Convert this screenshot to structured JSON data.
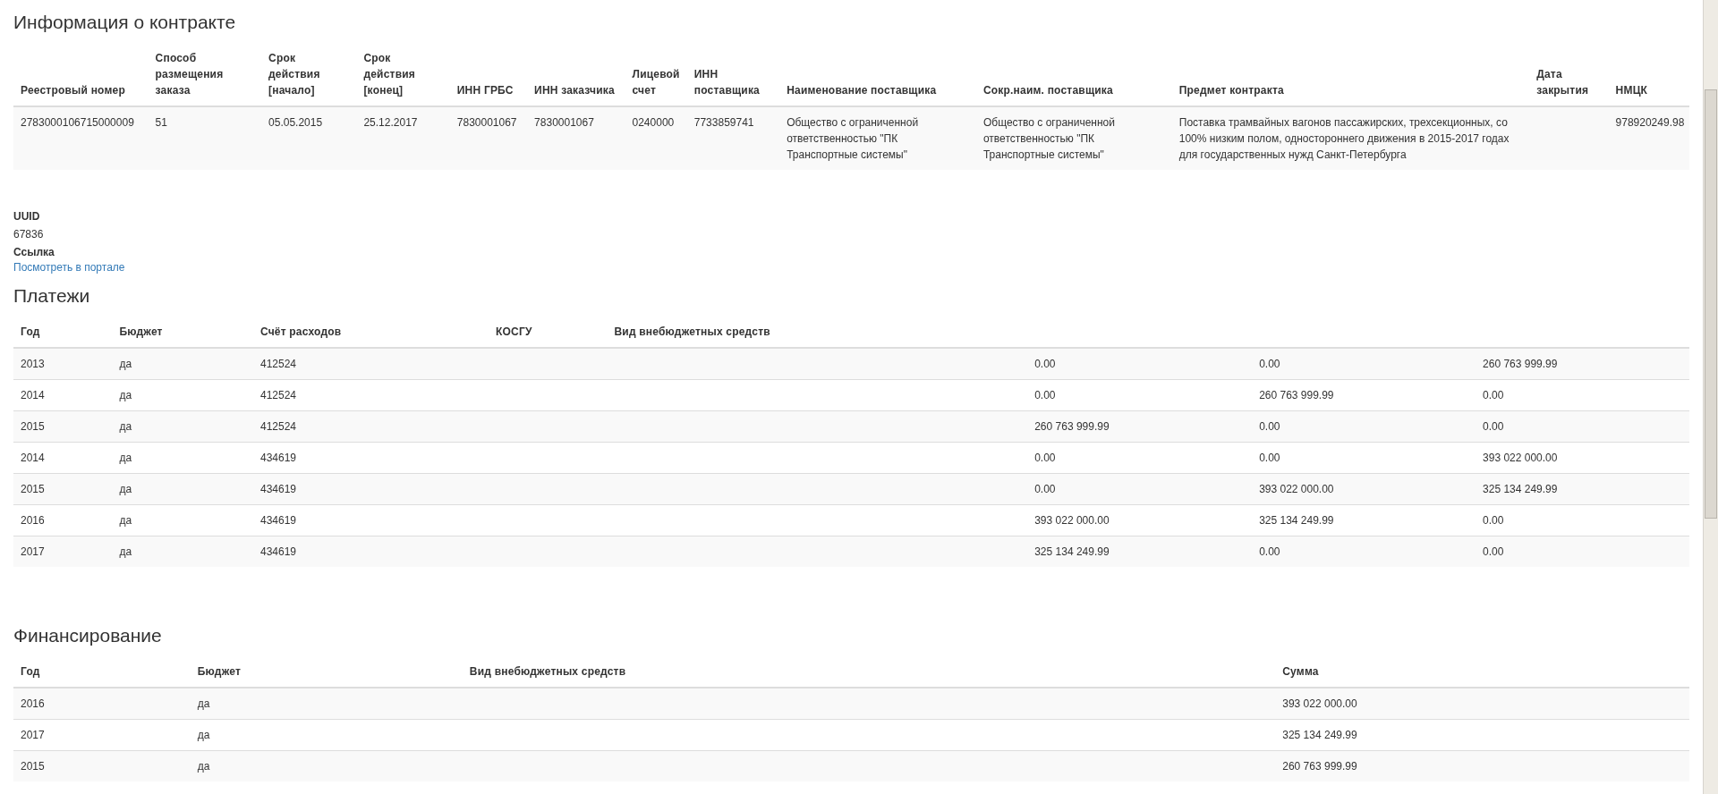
{
  "contract": {
    "title": "Информация о контракте",
    "columns": [
      "Реестровый номер",
      "Способ размещения заказа",
      "Срок действия [начало]",
      "Срок действия [конец]",
      "ИНН ГРБС",
      "ИНН заказчика",
      "Лицевой счет",
      "ИНН поставщика",
      "Наименование поставщика",
      "Сокр.наим. поставщика",
      "Предмет контракта",
      "Дата закрытия",
      "НМЦК"
    ],
    "rows": [
      [
        "2783000106715000009",
        "51",
        "05.05.2015",
        "25.12.2017",
        "7830001067",
        "7830001067",
        "0240000",
        "7733859741",
        "Общество с ограниченной ответственностью \"ПК Транспортные системы\"",
        "Общество с ограниченной ответственностью \"ПК Транспортные системы\"",
        "Поставка трамвайных вагонов пассажирских, трехсекционных, со 100% низким полом, одностороннего движения в 2015-2017 годах для государственных нужд Санкт-Петербурга",
        "",
        "978920249.98"
      ]
    ]
  },
  "details": [
    {
      "label": "UUID",
      "value": "67836",
      "kind": "text"
    },
    {
      "label": "Ссылка",
      "value": "Посмотреть в портале",
      "kind": "link"
    }
  ],
  "payments": {
    "title": "Платежи",
    "columns": [
      "Год",
      "Бюджет",
      "Счёт расходов",
      "КОСГУ",
      "Вид внебюджетных средств",
      "",
      "",
      ""
    ],
    "rows": [
      [
        "2013",
        "да",
        "412524",
        "",
        "",
        "0.00",
        "0.00",
        "260 763 999.99"
      ],
      [
        "2014",
        "да",
        "412524",
        "",
        "",
        "0.00",
        "260 763 999.99",
        "0.00"
      ],
      [
        "2015",
        "да",
        "412524",
        "",
        "",
        "260 763 999.99",
        "0.00",
        "0.00"
      ],
      [
        "2014",
        "да",
        "434619",
        "",
        "",
        "0.00",
        "0.00",
        "393 022 000.00"
      ],
      [
        "2015",
        "да",
        "434619",
        "",
        "",
        "0.00",
        "393 022 000.00",
        "325 134 249.99"
      ],
      [
        "2016",
        "да",
        "434619",
        "",
        "",
        "393 022 000.00",
        "325 134 249.99",
        "0.00"
      ],
      [
        "2017",
        "да",
        "434619",
        "",
        "",
        "325 134 249.99",
        "0.00",
        "0.00"
      ]
    ]
  },
  "financing": {
    "title": "Финансирование",
    "columns": [
      "Год",
      "Бюджет",
      "Вид внебюджетных средств",
      "Сумма"
    ],
    "rows": [
      [
        "2016",
        "да",
        "",
        "393 022 000.00"
      ],
      [
        "2017",
        "да",
        "",
        "325 134 249.99"
      ],
      [
        "2015",
        "да",
        "",
        "260 763 999.99"
      ]
    ]
  }
}
